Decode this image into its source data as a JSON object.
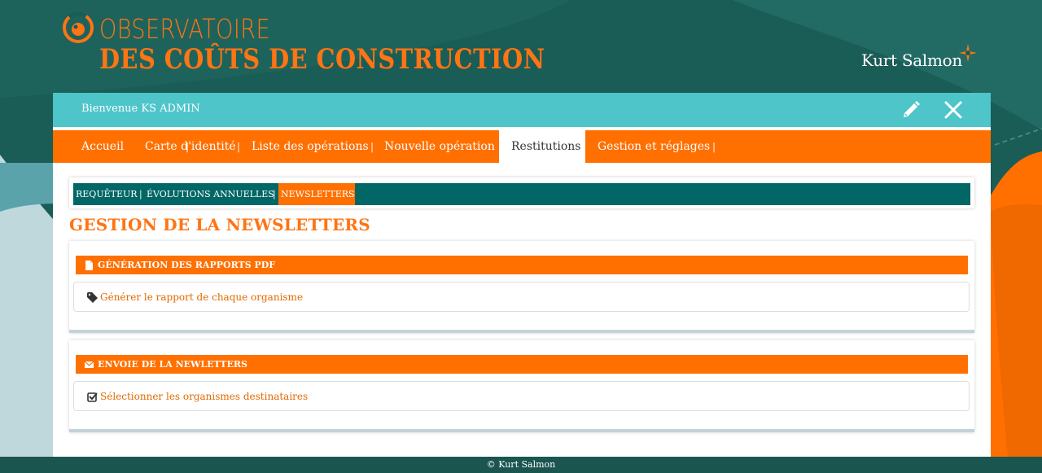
{
  "header": {
    "logo_line1": "OBSERVATOIRE",
    "logo_line2": "DES COÛTS DE CONSTRUCTION",
    "brand": "Kurt Salmon",
    "logo_icon": "eye-circle-icon",
    "brand_icon": "compass-star-icon"
  },
  "welcome": {
    "text": "Bienvenue KS ADMIN",
    "edit_icon": "pencil-icon",
    "close_icon": "close-icon"
  },
  "nav": {
    "items": [
      {
        "label": "Accueil"
      },
      {
        "label": "Carte d'identité"
      },
      {
        "label": "Liste des opérations"
      },
      {
        "label": "Nouvelle opération"
      },
      {
        "label": "Restitutions"
      },
      {
        "label": "Gestion et réglages"
      }
    ],
    "active": "Restitutions"
  },
  "subnav": {
    "items": [
      {
        "label": "REQUÊTEUR"
      },
      {
        "label": "ÉVOLUTIONS ANNUELLES"
      },
      {
        "label": "NEWSLETTERS"
      }
    ],
    "active": "NEWSLETTERS"
  },
  "page": {
    "title": "GESTION DE LA NEWSLETTERS"
  },
  "panels": [
    {
      "title": "GÉNÉRATION DES RAPPORTS PDF",
      "icon": "file-icon",
      "link": "Générer le rapport de chaque organisme",
      "link_icon": "tag-icon"
    },
    {
      "title": "ENVOIE DE LA NEWLETTERS",
      "icon": "envelope-icon",
      "link": "Sélectionner les organismes destinataires",
      "link_icon": "checkbox-icon"
    }
  ],
  "footer": {
    "text": "© Kurt Salmon"
  },
  "colors": {
    "orange": "#ff7000",
    "teal_dark": "#006666",
    "teal_light": "#4dc5c9",
    "background": "#1d5a55"
  }
}
